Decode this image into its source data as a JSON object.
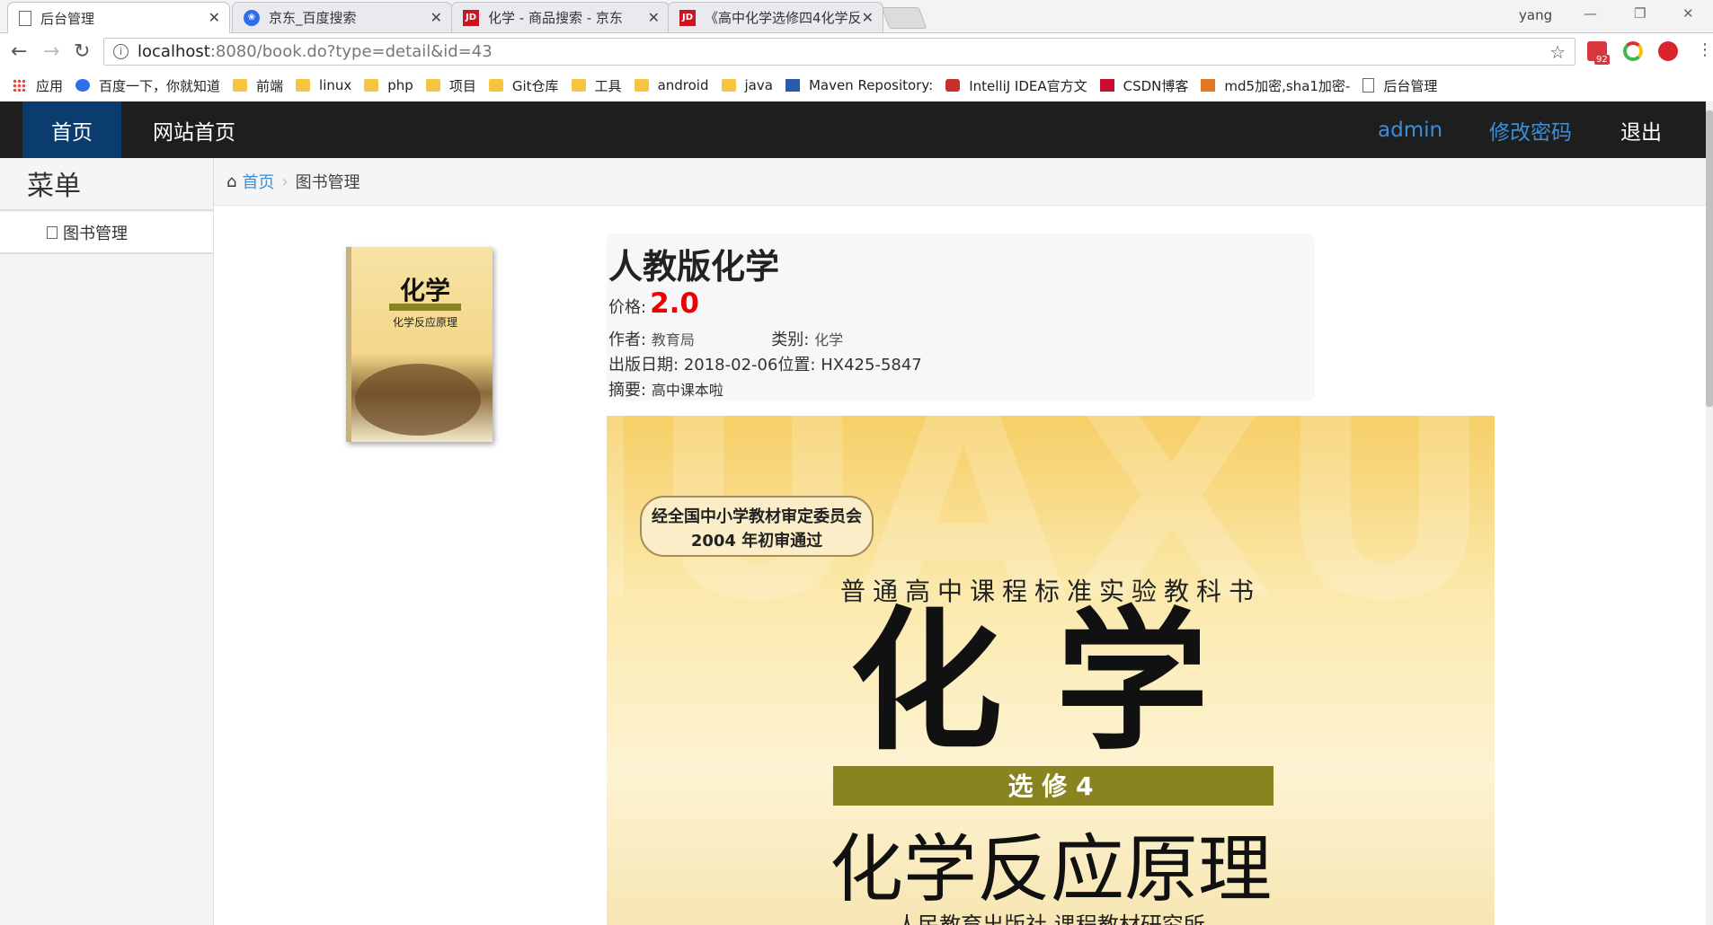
{
  "browser": {
    "tabs": [
      {
        "title": "后台管理",
        "icon": "page-icon"
      },
      {
        "title": "京东_百度搜索",
        "icon": "baidu-paw-icon"
      },
      {
        "title": "化学 - 商品搜索 - 京东",
        "icon": "jd-icon"
      },
      {
        "title": "《高中化学选修四4化学反",
        "icon": "jd-icon"
      }
    ],
    "user": "yang",
    "url_host": "localhost",
    "url_rest": ":8080/book.do?type=detail&id=43",
    "extension_badge": "92",
    "bookmarks": [
      {
        "label": "应用",
        "icon": "apps-grid-icon"
      },
      {
        "label": "百度一下，你就知道",
        "icon": "baidu-paw-icon"
      },
      {
        "label": "前端",
        "icon": "folder-icon"
      },
      {
        "label": "linux",
        "icon": "folder-icon"
      },
      {
        "label": "php",
        "icon": "folder-icon"
      },
      {
        "label": "项目",
        "icon": "folder-icon"
      },
      {
        "label": "Git仓库",
        "icon": "folder-icon"
      },
      {
        "label": "工具",
        "icon": "folder-icon"
      },
      {
        "label": "android",
        "icon": "folder-icon"
      },
      {
        "label": "java",
        "icon": "folder-icon"
      },
      {
        "label": "Maven Repository:",
        "icon": "mvn-icon"
      },
      {
        "label": "IntelliJ IDEA官方文",
        "icon": "w3c-icon"
      },
      {
        "label": "CSDN博客",
        "icon": "csdn-icon"
      },
      {
        "label": "md5加密,sha1加密-",
        "icon": "md5-icon"
      },
      {
        "label": "后台管理",
        "icon": "page-icon"
      }
    ]
  },
  "nav": {
    "home": "首页",
    "site_home": "网站首页",
    "admin": "admin",
    "change_password": "修改密码",
    "logout": "退出"
  },
  "sidebar": {
    "title": "菜单",
    "items": [
      {
        "label": "图书管理"
      }
    ]
  },
  "breadcrumb": {
    "home": "首页",
    "current": "图书管理"
  },
  "book": {
    "title": "人教版化学",
    "price_label": "价格:",
    "price": "2.0",
    "author_label": "作者:",
    "author": "教育局",
    "category_label": "类别:",
    "category": "化学",
    "date_label": "出版日期:",
    "date": "2018-02-06",
    "location_label": "位置:",
    "location": "HX425-5847",
    "summary_label": "摘要:",
    "summary": "高中课本啦"
  },
  "cover": {
    "approval_line1": "经全国中小学教材审定委员会",
    "approval_line2": "2004 年初审通过",
    "series": "普通高中课程标准实验教科书",
    "subject": "化 学",
    "band": "选 修 4",
    "subtitle": "化学反应原理",
    "publisher": "人民教育出版社 课程教材研究所",
    "thumb_subject": "化学",
    "thumb_subtitle": "化学反应原理"
  },
  "colors": {
    "nav_bg": "#1e1e1e",
    "nav_active": "#0b3c6e",
    "link": "#3b8fd9",
    "price": "#ee0000",
    "cover_band": "#8a8420"
  }
}
